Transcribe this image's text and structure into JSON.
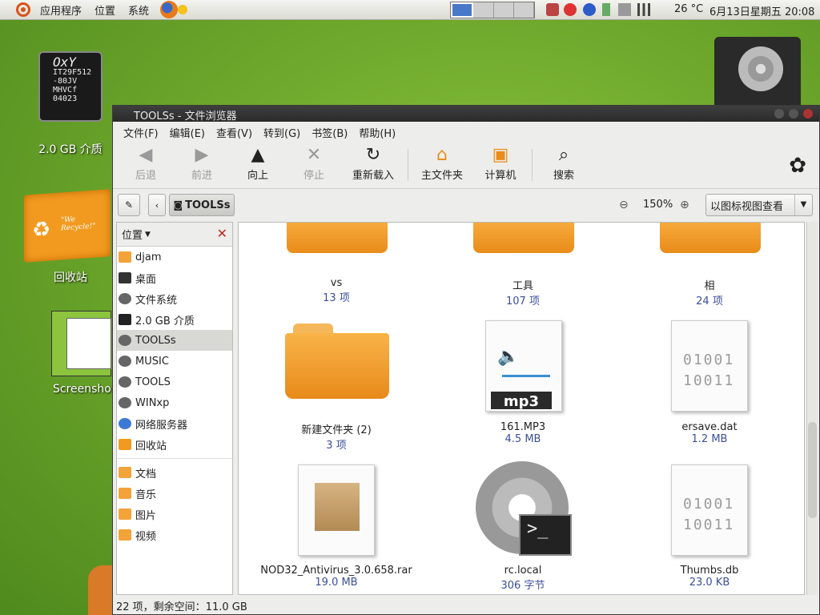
{
  "top_panel": {
    "menu": [
      "应用程序",
      "位置",
      "系统"
    ],
    "temperature": "26 °C",
    "clock": "6月13日星期五 20:08"
  },
  "desktop": {
    "chip_text": [
      "OxY",
      "IT29F512",
      "-80JV",
      "MHVCf",
      "04023"
    ],
    "media_label": "2.0 GB 介质",
    "trash_label": "回收站",
    "trash_badge": "\"We Recycle!\"",
    "screenshot_label": "Screensho"
  },
  "window": {
    "title": "TOOLSs - 文件浏览器",
    "menubar": [
      "文件(F)",
      "编辑(E)",
      "查看(V)",
      "转到(G)",
      "书签(B)",
      "帮助(H)"
    ],
    "toolbar": {
      "back": "后退",
      "forward": "前进",
      "up": "向上",
      "stop": "停止",
      "reload": "重新载入",
      "home": "主文件夹",
      "computer": "计算机",
      "search": "搜索"
    },
    "location": {
      "path_button": "TOOLSs",
      "zoom": "150%",
      "view_mode": "以图标视图查看"
    },
    "sidebar": {
      "title": "位置",
      "places": [
        {
          "label": "djam"
        },
        {
          "label": "桌面"
        },
        {
          "label": "文件系统"
        },
        {
          "label": "2.0 GB 介质"
        },
        {
          "label": "TOOLSs"
        },
        {
          "label": "MUSIC"
        },
        {
          "label": "TOOLS"
        },
        {
          "label": "WINxp"
        },
        {
          "label": "网络服务器"
        },
        {
          "label": "回收站"
        }
      ],
      "bookmarks": [
        {
          "label": "文档"
        },
        {
          "label": "音乐"
        },
        {
          "label": "图片"
        },
        {
          "label": "视频"
        }
      ]
    },
    "files": [
      {
        "name": "vs",
        "info": "13 项"
      },
      {
        "name": "工具",
        "info": "107 项"
      },
      {
        "name": "相",
        "info": "24 项"
      },
      {
        "name": "新建文件夹 (2)",
        "info": "3 项"
      },
      {
        "name": "161.MP3",
        "info": "4.5 MB",
        "badge": "mp3"
      },
      {
        "name": "ersave.dat",
        "info": "1.2 MB"
      },
      {
        "name": "NOD32_Antivirus_3.0.658.rar",
        "info": "19.0 MB"
      },
      {
        "name": "rc.local",
        "info": "306 字节"
      },
      {
        "name": "Thumbs.db",
        "info": "23.0 KB"
      }
    ],
    "binary_text": [
      "01001",
      "10011"
    ],
    "status": "22 项，剩余空间：11.0 GB"
  }
}
